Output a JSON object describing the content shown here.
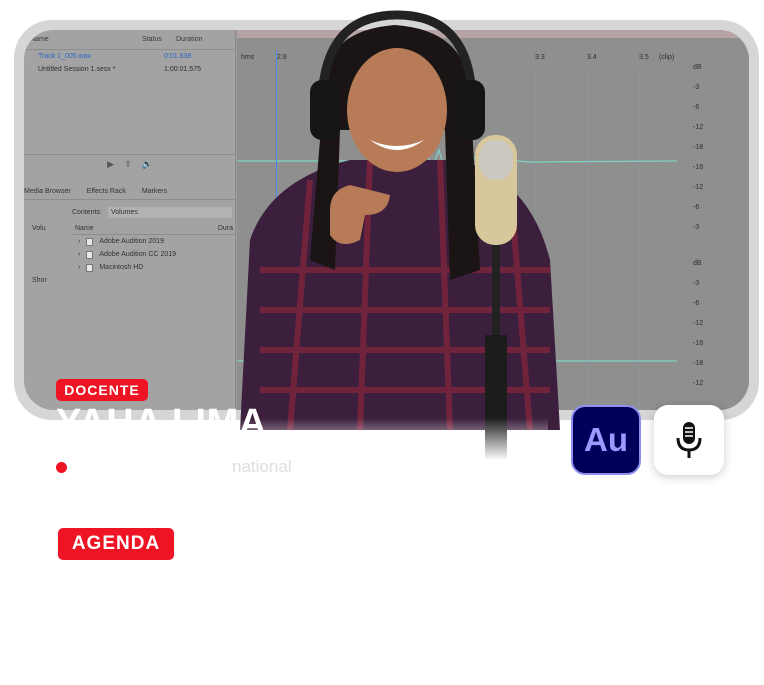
{
  "audition": {
    "files_header": {
      "name": "Name",
      "status": "Status",
      "duration": "Duration"
    },
    "files": [
      {
        "name": "Track 1_005.wav",
        "duration": "0:01.838",
        "active": true
      },
      {
        "name": "Untitled Session 1.sesx *",
        "duration": "1:00:01.575",
        "active": false
      }
    ],
    "tabs": [
      "Media Browser",
      "Effects Rack",
      "Markers"
    ],
    "contents_label": "Contents:",
    "contents_value": "Volumes",
    "tree_left": [
      "Volu",
      "",
      "",
      "",
      "Shor"
    ],
    "tree_header": {
      "name": "Name",
      "duration": "Dura"
    },
    "tree_items": [
      "Adobe Audition 2019",
      "Adobe Audition CC 2019",
      "Macintosh HD"
    ],
    "ruler": {
      "hms": "hms",
      "ticks": [
        "2.8",
        "3.3",
        "3.4",
        "3.5"
      ],
      "clip": "(clip)"
    },
    "db_top": [
      "dB",
      "-3",
      "-6",
      "-12",
      "-18",
      "-18",
      "-12",
      "-6",
      "-3"
    ],
    "db_bottom": [
      "dB",
      "-3",
      "-6",
      "-12",
      "-18",
      "-18",
      "-12"
    ]
  },
  "docente_label": "DOCENTE",
  "name": "YAHA LIMA",
  "subtitle": "national",
  "agenda_label": "AGENDA",
  "apps": {
    "audition": "Au",
    "mic": "microphone-icon"
  },
  "colors": {
    "accent": "#ee1424",
    "au_bg": "#00005b",
    "au_text": "#9a9aff",
    "wave": "#7fd3c4"
  }
}
